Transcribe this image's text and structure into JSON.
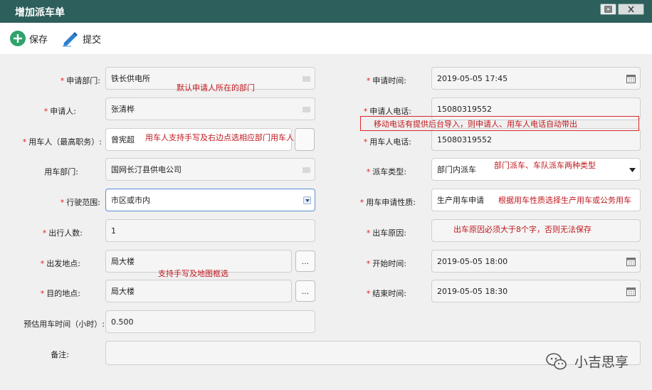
{
  "window": {
    "title": "增加派车单"
  },
  "toolbar": {
    "save_label": "保存",
    "submit_label": "提交"
  },
  "form": {
    "dept": {
      "label": "申请部门:",
      "value": "铁长供电所",
      "required": true
    },
    "applicant": {
      "label": "申请人:",
      "value": "张清桦",
      "required": true
    },
    "user": {
      "label": "用车人（最高职务）:",
      "value": "曾宪超",
      "required": true
    },
    "use_dept": {
      "label": "用车部门:",
      "value": "国网长汀县供电公司",
      "required": false
    },
    "range": {
      "label": "行驶范围:",
      "value": "市区或市内",
      "required": true
    },
    "people": {
      "label": "出行人数:",
      "value": "1",
      "required": true
    },
    "from": {
      "label": "出发地点:",
      "value": "局大楼",
      "required": true
    },
    "to": {
      "label": "目的地点:",
      "value": "局大楼",
      "required": true
    },
    "hours": {
      "label": "预估用车时间（小时）:",
      "value": "0.500",
      "required": false
    },
    "remark": {
      "label": "备注:",
      "value": "",
      "required": false
    },
    "apply_time": {
      "label": "申请时间:",
      "value": "2019-05-05 17:45",
      "required": true
    },
    "applicant_phone": {
      "label": "申请人电话:",
      "value": "15080319552",
      "required": true
    },
    "user_phone": {
      "label": "用车人电话:",
      "value": "15080319552",
      "required": true
    },
    "dispatch_type": {
      "label": "派车类型:",
      "value": "部门内派车",
      "required": true
    },
    "use_nature": {
      "label": "用车申请性质:",
      "value": "生产用车申请",
      "required": true
    },
    "reason": {
      "label": "出车原因:",
      "value": "",
      "required": true
    },
    "start_time": {
      "label": "开始时间:",
      "value": "2019-05-05 18:00",
      "required": true
    },
    "end_time": {
      "label": "结束时间:",
      "value": "2019-05-05 18:30",
      "required": true
    },
    "dots_label": "..."
  },
  "annotations": {
    "dept_note": "默认申请人所在的部门",
    "user_note": "用车人支持手写及右边点选相应部门用车人",
    "map_note": "支持手写及地图框选",
    "phone_note": "移动电话有提供后台导入，则申请人、用车人电话自动带出",
    "type_note": "部门派车、车队派车两种类型",
    "nature_note": "根据用车性质选择生产用车或公务用车",
    "reason_note": "出车原因必须大于8个字，否则无法保存"
  },
  "watermark": {
    "text": "小吉思享",
    "icon": "wechat-icon"
  },
  "colors": {
    "titlebar": "#2d5f5c",
    "annotation": "#c0181e",
    "required_star": "#d22222",
    "add_icon": "#2fa36b",
    "submit_icon": "#2d7fd0"
  }
}
